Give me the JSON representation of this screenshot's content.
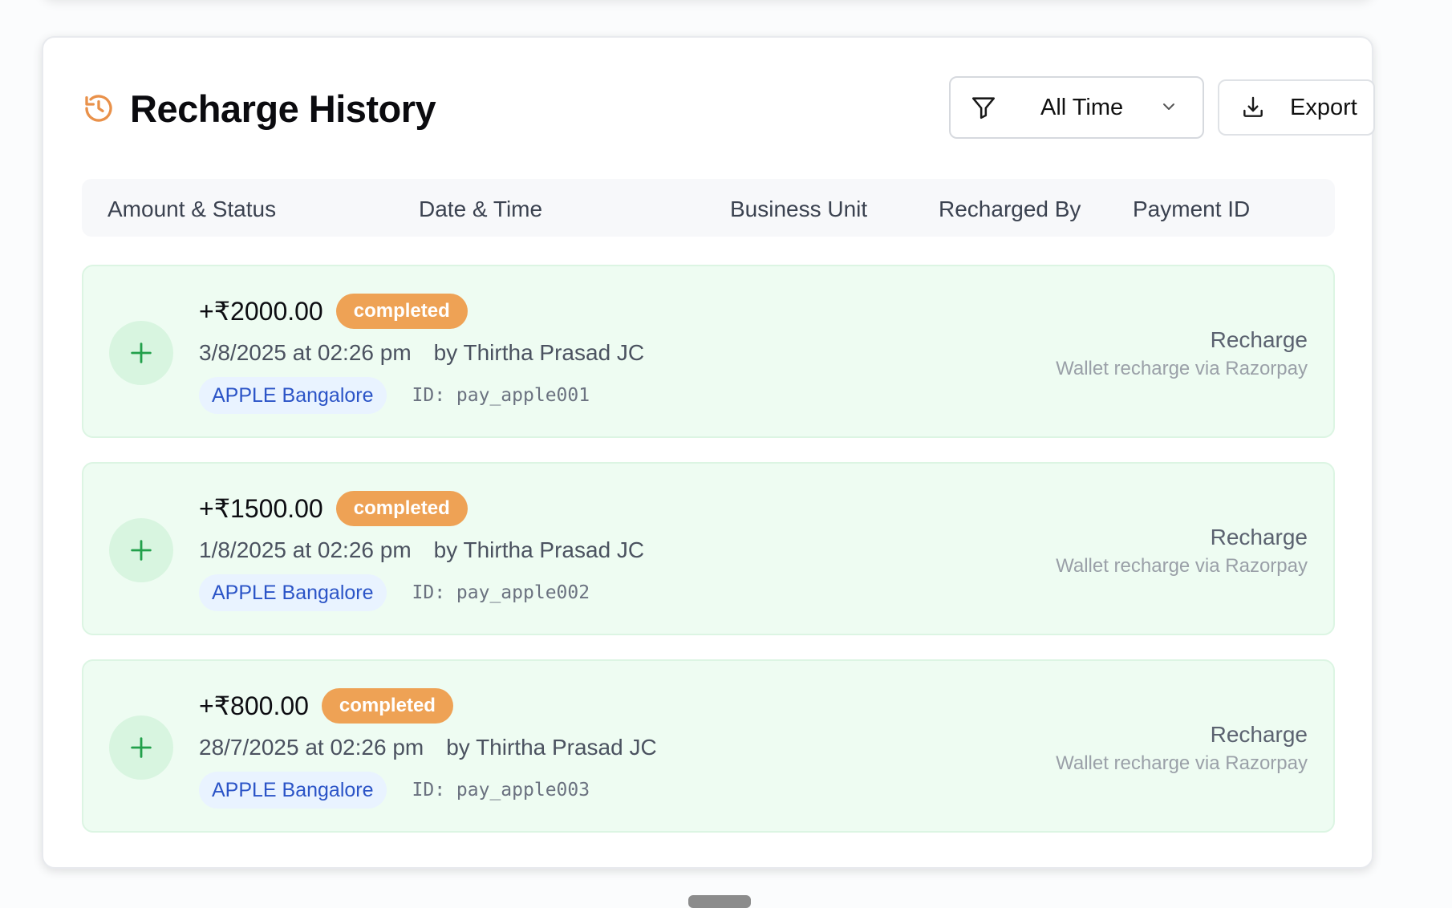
{
  "header": {
    "title": "Recharge History",
    "filter": {
      "selected": "All Time"
    },
    "export_label": "Export"
  },
  "table": {
    "columns": [
      "Amount & Status",
      "Date & Time",
      "Business Unit",
      "Recharged By",
      "Payment ID"
    ]
  },
  "rows": [
    {
      "amount": "+₹2000.00",
      "status": "completed",
      "datetime": "3/8/2025 at 02:26 pm",
      "by": "by Thirtha Prasad JC",
      "business_unit": "APPLE Bangalore",
      "payment_id": "ID: pay_apple001",
      "type": "Recharge",
      "description": "Wallet recharge via Razorpay"
    },
    {
      "amount": "+₹1500.00",
      "status": "completed",
      "datetime": "1/8/2025 at 02:26 pm",
      "by": "by Thirtha Prasad JC",
      "business_unit": "APPLE Bangalore",
      "payment_id": "ID: pay_apple002",
      "type": "Recharge",
      "description": "Wallet recharge via Razorpay"
    },
    {
      "amount": "+₹800.00",
      "status": "completed",
      "datetime": "28/7/2025 at 02:26 pm",
      "by": "by Thirtha Prasad JC",
      "business_unit": "APPLE Bangalore",
      "payment_id": "ID: pay_apple003",
      "type": "Recharge",
      "description": "Wallet recharge via Razorpay"
    }
  ],
  "icons": {
    "title": "history-icon",
    "filter": "filter-icon",
    "dropdown": "chevron-down-icon",
    "export": "download-icon",
    "row": "plus-icon"
  },
  "colors": {
    "accent": "#eea255",
    "row_bg": "#eefcf2",
    "plus_green": "#22a04b",
    "business_unit_text": "#2b54c7"
  }
}
